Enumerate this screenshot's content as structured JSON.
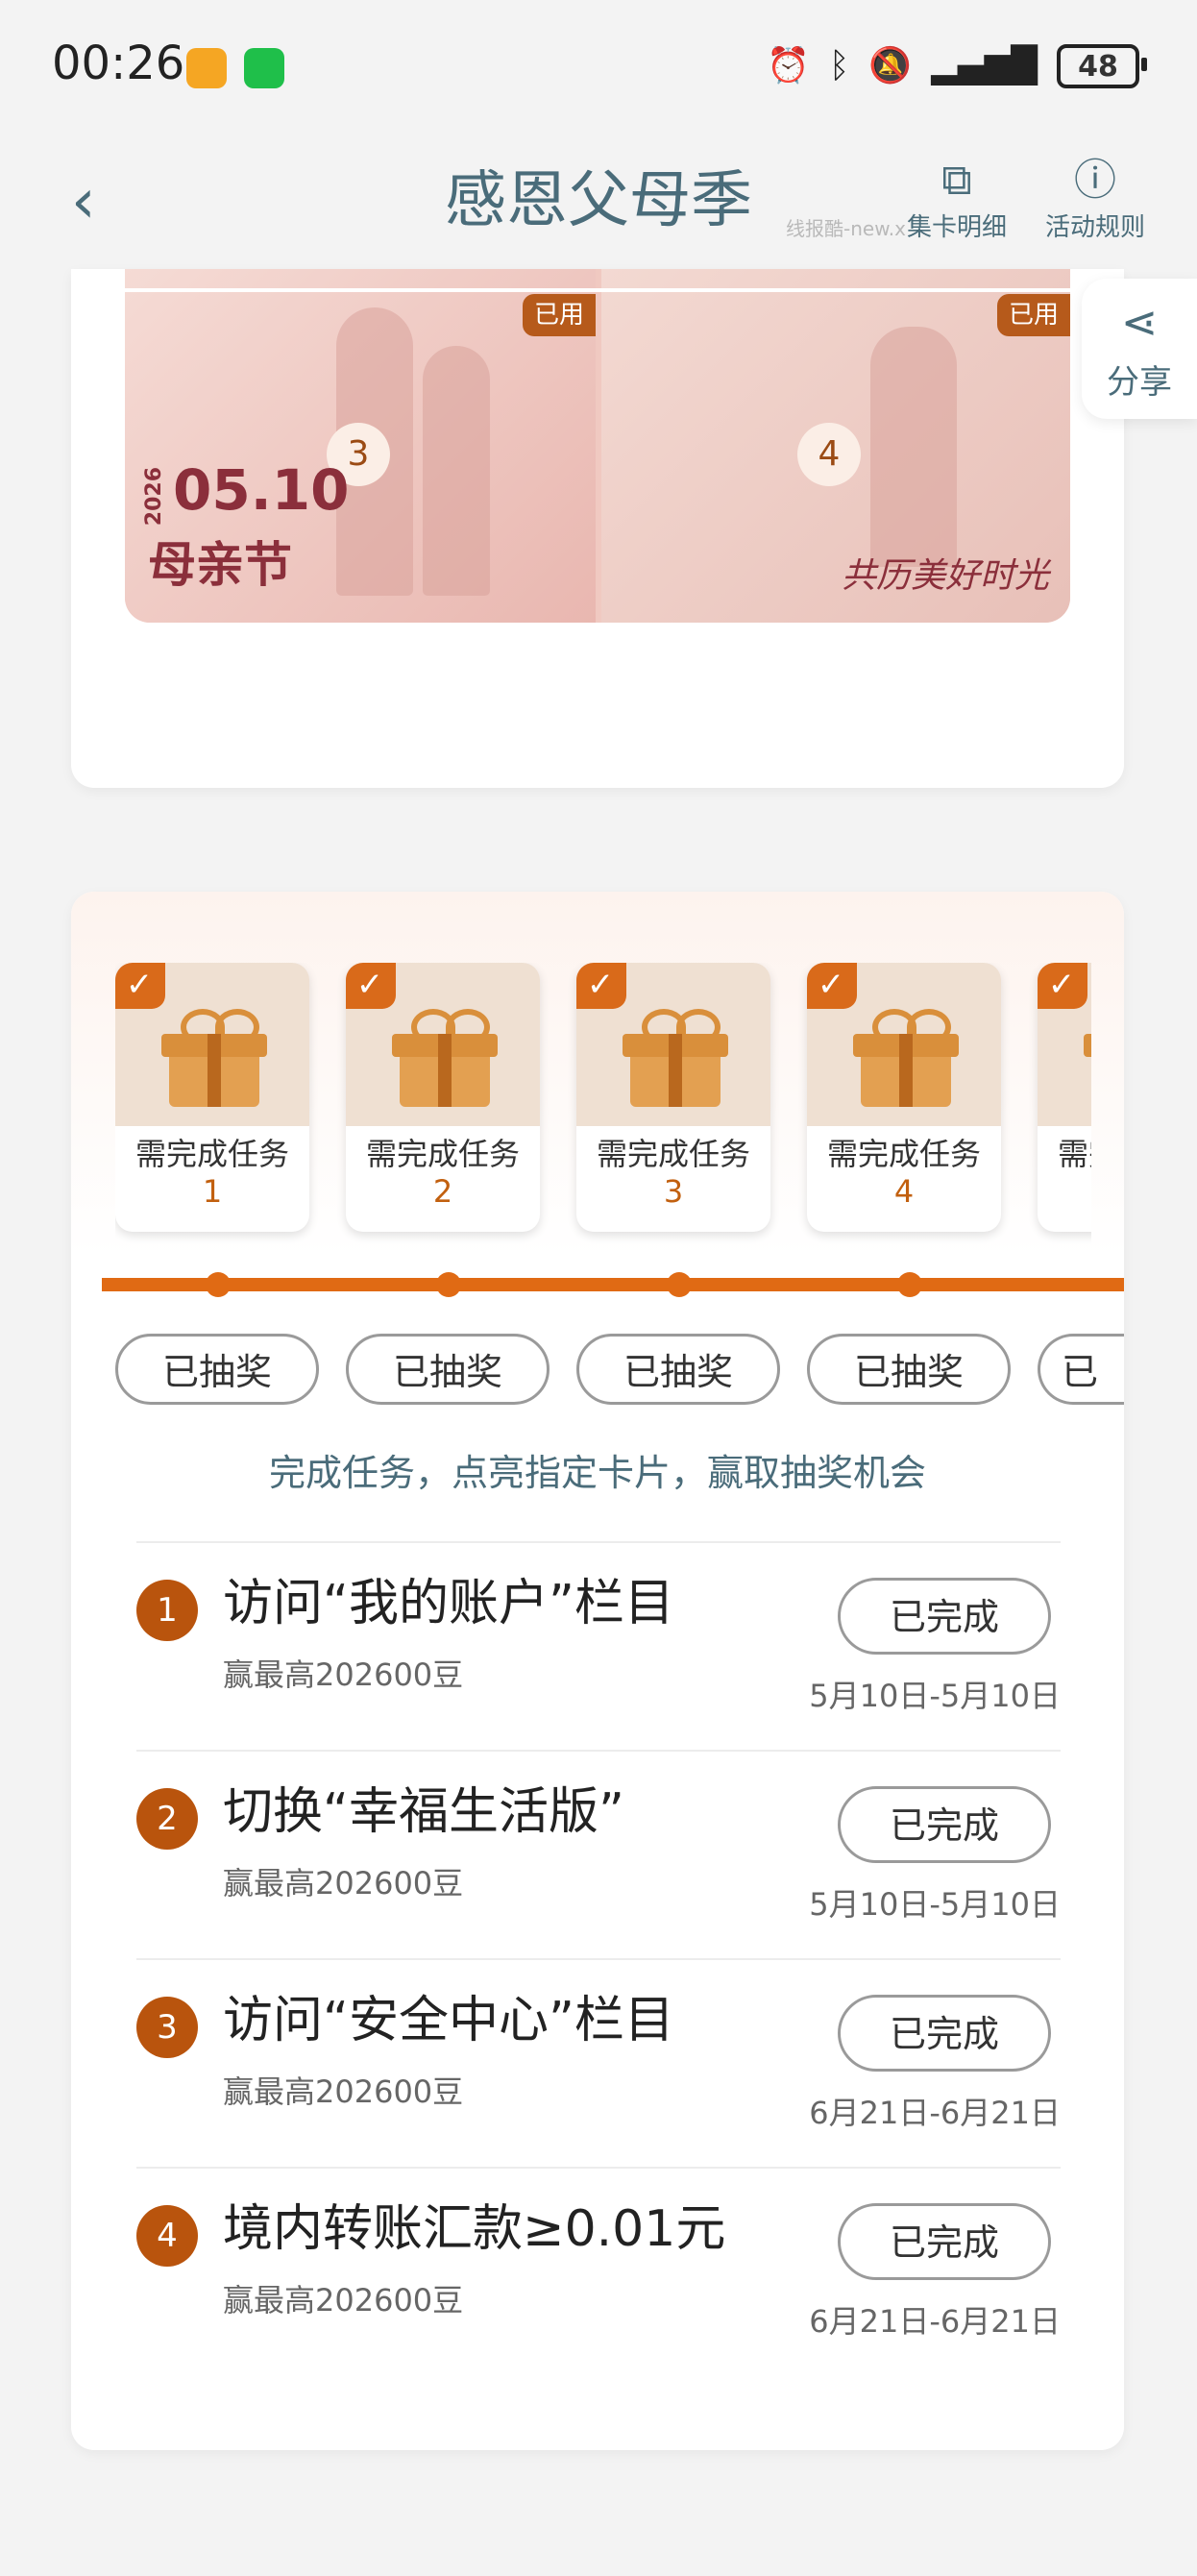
{
  "status_bar": {
    "time": "00:26",
    "battery": "48",
    "right_icons": [
      "alarm-icon",
      "bluetooth-icon",
      "mute-icon",
      "signal-icon"
    ]
  },
  "navbar": {
    "title": "感恩父母季",
    "cards_label": "集卡明细",
    "rules_label": "活动规则",
    "watermark": "线报酷-new.x"
  },
  "photos": {
    "used_tag": "已用",
    "card3_number": "3",
    "card4_number": "4",
    "date_year": "2026",
    "date": "05.10",
    "holiday": "母亲节",
    "slogan": "共历美好时光"
  },
  "share": {
    "label": "分享"
  },
  "rewards": {
    "items": [
      {
        "label": "需完成任务",
        "num": "1"
      },
      {
        "label": "需完成任务",
        "num": "2"
      },
      {
        "label": "需完成任务",
        "num": "3"
      },
      {
        "label": "需完成任务",
        "num": "4"
      },
      {
        "label": "需完成任务",
        "num": ""
      }
    ],
    "drawn_label": "已抽奖",
    "hint": "完成任务，点亮指定卡片，赢取抽奖机会"
  },
  "tasks": [
    {
      "num": "1",
      "title": "访问“我的账户”栏目",
      "reward": "赢最高202600豆",
      "status": "已完成",
      "date": "5月10日-5月10日"
    },
    {
      "num": "2",
      "title": "切换“幸福生活版”",
      "reward": "赢最高202600豆",
      "status": "已完成",
      "date": "5月10日-5月10日"
    },
    {
      "num": "3",
      "title": "访问“安全中心”栏目",
      "reward": "赢最高202600豆",
      "status": "已完成",
      "date": "6月21日-6月21日"
    },
    {
      "num": "4",
      "title": "境内转账汇款≥0.01元",
      "reward": "赢最高202600豆",
      "status": "已完成",
      "date": "6月21日-6月21日"
    }
  ],
  "colors": {
    "accent": "#e06a14",
    "title": "#4a6c7a",
    "tag": "#b65a1b"
  }
}
